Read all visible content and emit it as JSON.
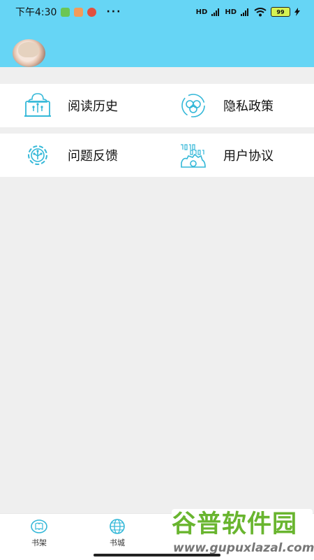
{
  "status_bar": {
    "time": "下午4:30",
    "more": "···",
    "signal_1": "HD",
    "signal_2": "HD",
    "battery": "99"
  },
  "menu": {
    "reading_history": "阅读历史",
    "privacy_policy": "隐私政策",
    "feedback": "问题反馈",
    "user_agreement": "用户协议"
  },
  "tabs": {
    "bookshelf": "书架",
    "bookstore": "书城"
  },
  "watermark": {
    "logo": "谷普软件园",
    "url": "www.gupuxlazal.com"
  },
  "colors": {
    "header": "#66d5f5",
    "accent": "#34b8d8",
    "background": "#efefef"
  }
}
